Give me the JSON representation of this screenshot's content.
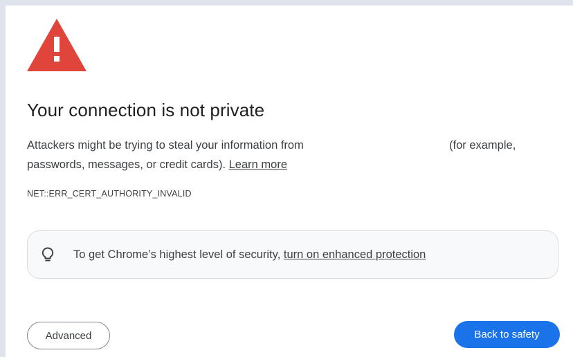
{
  "page": {
    "title": "Your connection is not private",
    "description_line1": "Attackers might be trying to steal your information from",
    "description_line1_cont": "(for example,",
    "description_line2": "passwords, messages, or credit cards).",
    "learn_more": "Learn more",
    "error_code": "NET::ERR_CERT_AUTHORITY_INVALID"
  },
  "enhanced_protection": {
    "text": "To get Chrome’s highest level of security,",
    "link": "turn on enhanced protection"
  },
  "buttons": {
    "advanced": "Advanced",
    "back_to_safety": "Back to safety"
  },
  "icons": {
    "warning": "warning-triangle-icon",
    "lightbulb": "lightbulb-icon"
  },
  "colors": {
    "warning_red": "#e0453b",
    "primary_blue": "#1a73e8",
    "text_dark": "#202124",
    "text_body": "#3c4043"
  }
}
